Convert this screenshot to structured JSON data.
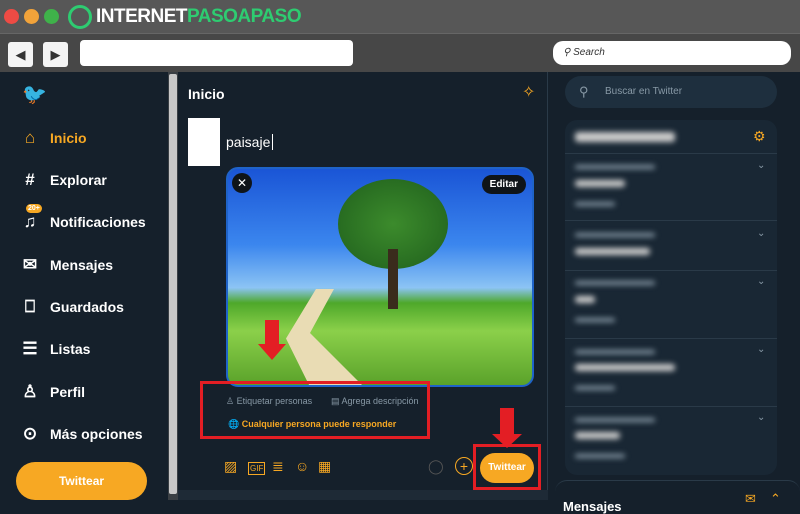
{
  "browser": {
    "logo_text_white": "INTERNET",
    "logo_text_green": "PASOAPASO",
    "search_placeholder": "Search",
    "back": "◀",
    "forward": "▶"
  },
  "colors": {
    "accent": "#f7a823",
    "background": "#15202b",
    "highlight": "#e31e24"
  },
  "sidebar": {
    "items": [
      {
        "label": "Inicio",
        "icon": "home-icon",
        "glyph": "⌂"
      },
      {
        "label": "Explorar",
        "icon": "hashtag-icon",
        "glyph": "#"
      },
      {
        "label": "Notificaciones",
        "icon": "bell-icon",
        "glyph": "🔔",
        "badge": "20+"
      },
      {
        "label": "Mensajes",
        "icon": "mail-icon",
        "glyph": "✉"
      },
      {
        "label": "Guardados",
        "icon": "bookmark-icon",
        "glyph": "🔖"
      },
      {
        "label": "Listas",
        "icon": "list-icon",
        "glyph": "☰"
      },
      {
        "label": "Perfil",
        "icon": "user-icon",
        "glyph": "👤"
      },
      {
        "label": "Más opciones",
        "icon": "more-icon",
        "glyph": "⋯"
      }
    ],
    "tweet_button": "Twittear"
  },
  "main": {
    "title": "Inicio",
    "compose_text": "paisaje",
    "edit_label": "Editar",
    "tag_people": "Etiquetar personas",
    "add_description": "Agrega descripción",
    "reply_setting": "Cualquier persona puede responder",
    "tweet_button": "Twittear"
  },
  "right": {
    "search_placeholder": "Buscar en Twitter",
    "messages_title": "Mensajes"
  }
}
